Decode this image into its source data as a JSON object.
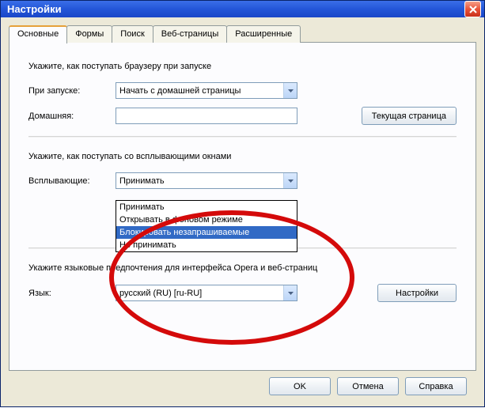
{
  "window": {
    "title": "Настройки"
  },
  "tabs": [
    {
      "label": "Основные"
    },
    {
      "label": "Формы"
    },
    {
      "label": "Поиск"
    },
    {
      "label": "Веб-страницы"
    },
    {
      "label": "Расширенные"
    }
  ],
  "startup": {
    "section_label": "Укажите, как поступать браузеру при запуске",
    "on_start_label": "При запуске:",
    "on_start_value": "Начать с домашней страницы",
    "home_label": "Домашняя:",
    "home_value": "",
    "current_page_btn": "Текущая страница"
  },
  "popups": {
    "section_label": "Укажите, как поступать со всплывающими окнами",
    "popups_label": "Всплывающие:",
    "popups_value": "Принимать",
    "options": [
      "Принимать",
      "Открывать в фоновом режиме",
      "Блокировать незапрашиваемые",
      "Не принимать"
    ],
    "selected_index": 2
  },
  "language": {
    "section_label": "Укажите языковые предпочтения для интерфейса Opera и веб-страниц",
    "lang_label": "Язык:",
    "lang_value": "русский (RU) [ru-RU]",
    "settings_btn": "Настройки"
  },
  "buttons": {
    "ok": "OK",
    "cancel": "Отмена",
    "help": "Справка"
  }
}
